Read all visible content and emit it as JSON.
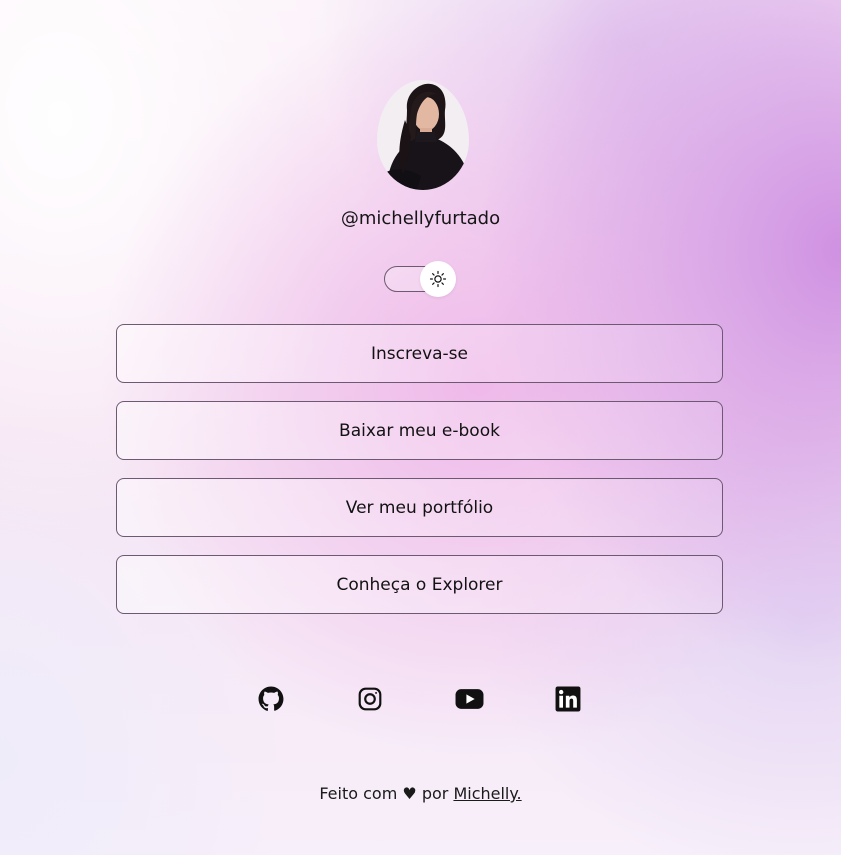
{
  "profile": {
    "username": "@michellyfurtado"
  },
  "theme_toggle": {
    "icon": "sun-icon"
  },
  "links": [
    {
      "label": "Inscreva-se"
    },
    {
      "label": "Baixar meu e-book"
    },
    {
      "label": "Ver meu portfólio"
    },
    {
      "label": "Conheça o Explorer"
    }
  ],
  "social": [
    {
      "icon": "github-icon"
    },
    {
      "icon": "instagram-icon"
    },
    {
      "icon": "youtube-icon"
    },
    {
      "icon": "linkedin-icon"
    }
  ],
  "footer": {
    "prefix": "Feito com",
    "heart": "♥",
    "by": "por",
    "author_link": "Michelly."
  },
  "colors": {
    "accent": "#d49be6",
    "button_border": "#6d5a72",
    "text": "#121212"
  }
}
